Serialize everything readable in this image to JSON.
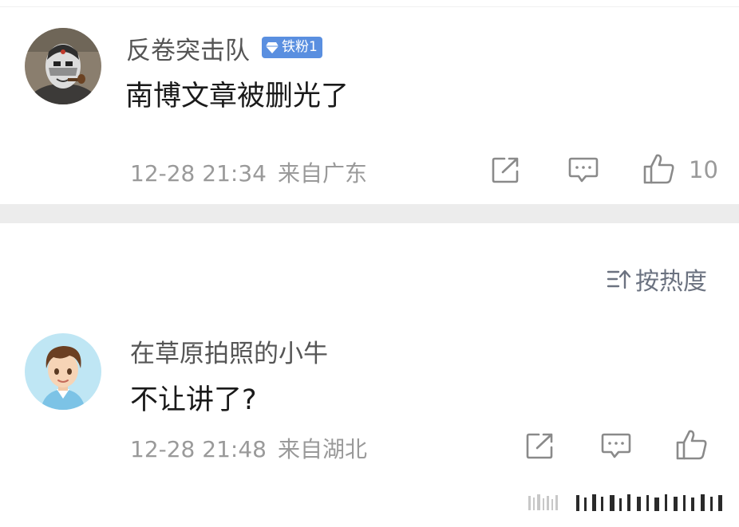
{
  "comments": [
    {
      "username": "反卷突击队",
      "badge": "铁粉1",
      "text": "南博文章被删光了",
      "time": "12-28 21:34",
      "location": "来自广东",
      "likes": "10",
      "avatar_icon": "masked-gentleman-pipe-avatar"
    },
    {
      "username": "在草原拍照的小牛",
      "text": "不让讲了?",
      "time": "12-28 21:48",
      "location": "来自湖北",
      "avatar_icon": "cartoon-boy-avatar"
    }
  ],
  "sort": {
    "label": "按热度",
    "icon": "sort-lines-arrow-icon"
  },
  "icons": {
    "share": "share-icon",
    "comment": "comment-icon",
    "like": "thumbs-up-icon"
  },
  "colors": {
    "badge": "#5a8fe0",
    "meta_text": "#9a9a9a",
    "divider": "#ececec",
    "icon_gray": "#8a8a8a"
  }
}
